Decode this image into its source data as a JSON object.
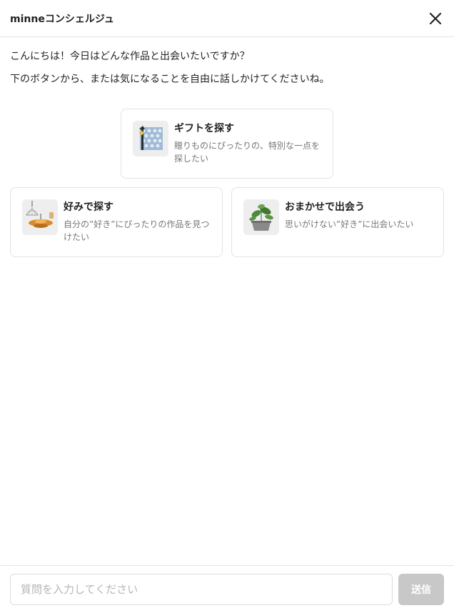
{
  "header": {
    "title": "minneコンシェルジュ",
    "close_icon": "close-icon"
  },
  "messages": [
    "こんにちは！今日はどんな作品と出会いたいですか？",
    "下のボタンから、または気になることを自由に話しかけてくださいね。"
  ],
  "options": [
    {
      "title": "ギフトを探す",
      "description": "贈りものにぴったりの、特別な一点を探したい",
      "icon": "gift-thumbnail"
    },
    {
      "title": "好みで探す",
      "description": "自分の”好き”にぴったりの作品を見つけたい",
      "icon": "lamp-thumbnail"
    },
    {
      "title": "おまかせで出会う",
      "description": "思いがけない”好き”に出会いたい",
      "icon": "plant-thumbnail"
    }
  ],
  "composer": {
    "placeholder": "質問を入力してください",
    "send_label": "送信"
  },
  "colors": {
    "send_button_disabled": "#c8c8c8",
    "border": "#e3e3e3"
  }
}
